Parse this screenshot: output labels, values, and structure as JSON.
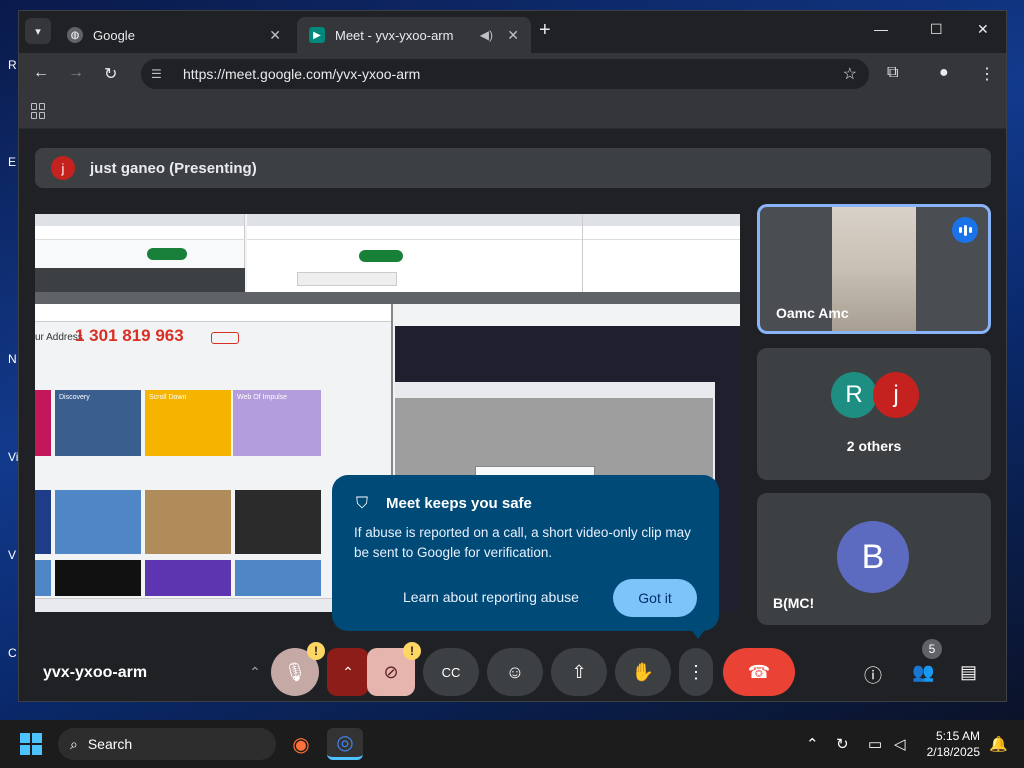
{
  "desktop": {
    "edge_letters": [
      "R",
      "E",
      "N",
      "Vis",
      "V",
      "C"
    ]
  },
  "tabs": [
    {
      "label": "Google",
      "active": false
    },
    {
      "label": "Meet - yvx-yxoo-arm",
      "active": true
    }
  ],
  "address_bar": {
    "url": "https://meet.google.com/yvx-yxoo-arm"
  },
  "presenting_bar": {
    "initial": "j",
    "text": "just ganeo (Presenting)"
  },
  "shared_screen": {
    "phone_number": "1 301 819 963",
    "address_label": "ur Address",
    "cards": [
      "Discovery",
      "Scroll Down",
      "Web Of Impulse"
    ]
  },
  "participants": [
    {
      "name": "Oamc Amc",
      "speaking": true
    },
    {
      "name": "2 others",
      "initials": [
        "R",
        "j"
      ],
      "colors": [
        "#1e8e82",
        "#c5221f"
      ]
    },
    {
      "name": "B(MC!",
      "initial": "B",
      "color": "#5c6bc0"
    }
  ],
  "popup": {
    "title": "Meet keeps you safe",
    "body": "If abuse is reported on a call, a short video-only clip may be sent to Google for verification.",
    "learn_link": "Learn about reporting abuse",
    "button": "Got it"
  },
  "controls": {
    "meeting_code": "yvx-yxoo-arm",
    "warning_badge": "!",
    "people_count": "5"
  },
  "taskbar": {
    "search_label": "Search",
    "time": "5:15 AM",
    "date": "2/18/2025"
  },
  "colors": {
    "end_call": "#ea4335",
    "accent": "#8ab4f8",
    "popup_bg": "#004a77"
  }
}
